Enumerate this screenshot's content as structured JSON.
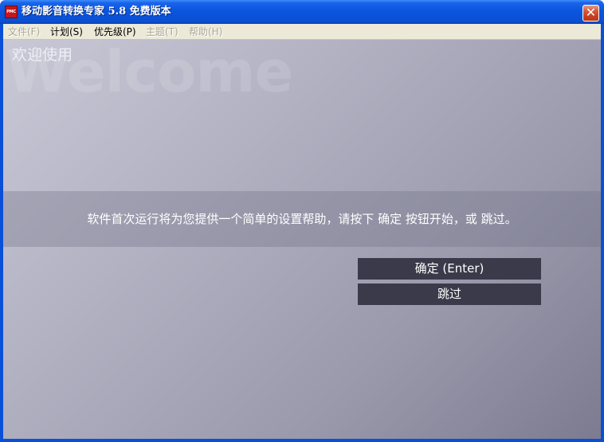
{
  "window": {
    "title": "移动影音转换专家 5.8 免费版本",
    "icon_text": "PMC",
    "close_glyph": "✕"
  },
  "menu": {
    "items": [
      {
        "label": "文件(F)",
        "enabled": false
      },
      {
        "label": "计划(S)",
        "enabled": true
      },
      {
        "label": "优先级(P)",
        "enabled": true
      },
      {
        "label": "主题(T)",
        "enabled": false
      },
      {
        "label": "帮助(H)",
        "enabled": false
      }
    ]
  },
  "welcome": {
    "watermark": "Welcome",
    "title": "欢迎使用",
    "message": "软件首次运行将为您提供一个简单的设置帮助，请按下 确定 按钮开始，或 跳过。"
  },
  "buttons": {
    "ok_label": "确定 (Enter)",
    "skip_label": "跳过"
  },
  "colors": {
    "titlebar": "#0a52d8",
    "button_bg": "#3a3a4a",
    "menubar_bg": "#ece9d8"
  },
  "icons": {
    "app": "app-logo-icon",
    "close": "close-icon"
  }
}
